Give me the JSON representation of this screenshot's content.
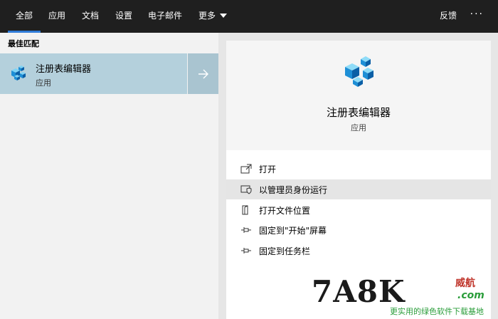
{
  "tabs": [
    {
      "label": "全部",
      "active": true
    },
    {
      "label": "应用"
    },
    {
      "label": "文档"
    },
    {
      "label": "设置"
    },
    {
      "label": "电子邮件"
    },
    {
      "label": "更多"
    }
  ],
  "header": {
    "feedback": "反馈",
    "more_options": "···"
  },
  "left": {
    "section_title": "最佳匹配",
    "best_match": {
      "name": "注册表编辑器",
      "type": "应用",
      "icon": "registry-editor-icon"
    }
  },
  "detail": {
    "name": "注册表编辑器",
    "type": "应用",
    "actions": [
      {
        "label": "打开",
        "icon": "open-icon"
      },
      {
        "label": "以管理员身份运行",
        "icon": "run-as-admin-icon",
        "highlighted": true
      },
      {
        "label": "打开文件位置",
        "icon": "file-location-icon"
      },
      {
        "label": "固定到\"开始\"屏幕",
        "icon": "pin-icon"
      },
      {
        "label": "固定到任务栏",
        "icon": "pin-icon"
      }
    ]
  },
  "watermark": {
    "brand": "7A8K",
    "cn": "威航",
    "domain": ".com",
    "slogan": "更实用的绿色软件下载基地"
  },
  "colors": {
    "topbar": "#1f1f1f",
    "accent": "#2f7bd8",
    "selection": "#b4d0dc"
  }
}
